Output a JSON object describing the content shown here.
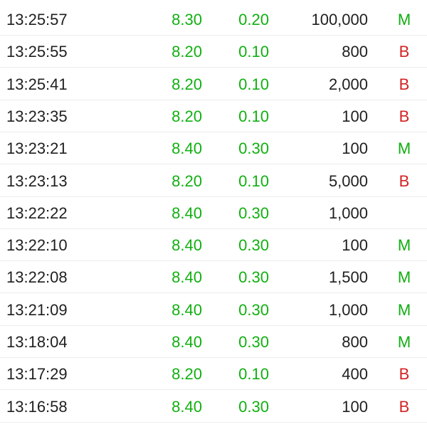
{
  "colors": {
    "up": "#11b011",
    "buy_marker": "#0fae0f",
    "sell_marker": "#d42222",
    "text": "#1f1f1f",
    "divider": "#ececec"
  },
  "trades": [
    {
      "time": "13:25:57",
      "price": "8.30",
      "change": "0.20",
      "volume": "100,000",
      "side": "M"
    },
    {
      "time": "13:25:55",
      "price": "8.20",
      "change": "0.10",
      "volume": "800",
      "side": "B"
    },
    {
      "time": "13:25:41",
      "price": "8.20",
      "change": "0.10",
      "volume": "2,000",
      "side": "B"
    },
    {
      "time": "13:23:35",
      "price": "8.20",
      "change": "0.10",
      "volume": "100",
      "side": "B"
    },
    {
      "time": "13:23:21",
      "price": "8.40",
      "change": "0.30",
      "volume": "100",
      "side": "M"
    },
    {
      "time": "13:23:13",
      "price": "8.20",
      "change": "0.10",
      "volume": "5,000",
      "side": "B"
    },
    {
      "time": "13:22:22",
      "price": "8.40",
      "change": "0.30",
      "volume": "1,000",
      "side": ""
    },
    {
      "time": "13:22:10",
      "price": "8.40",
      "change": "0.30",
      "volume": "100",
      "side": "M"
    },
    {
      "time": "13:22:08",
      "price": "8.40",
      "change": "0.30",
      "volume": "1,500",
      "side": "M"
    },
    {
      "time": "13:21:09",
      "price": "8.40",
      "change": "0.30",
      "volume": "1,000",
      "side": "M"
    },
    {
      "time": "13:18:04",
      "price": "8.40",
      "change": "0.30",
      "volume": "800",
      "side": "M"
    },
    {
      "time": "13:17:29",
      "price": "8.20",
      "change": "0.10",
      "volume": "400",
      "side": "B"
    },
    {
      "time": "13:16:58",
      "price": "8.40",
      "change": "0.30",
      "volume": "100",
      "side": "B"
    }
  ]
}
